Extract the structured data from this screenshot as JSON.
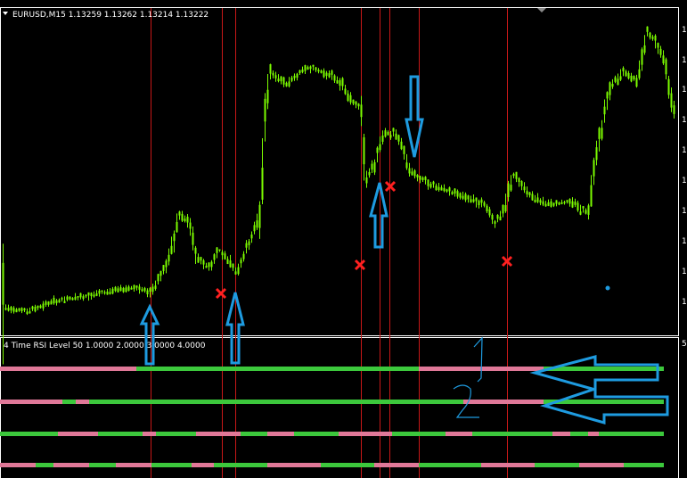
{
  "main_chart": {
    "header": "EURUSD,M15  1.13259 1.13262 1.13214 1.13222",
    "price_axis_ticks": [
      "1",
      "1",
      "1",
      "1",
      "1",
      "1",
      "1",
      "1",
      "1",
      "1"
    ]
  },
  "sub_window": {
    "header": "4 Time RSI Level 50 1.0000 2.0000 3.0000 4.0000",
    "axis_tick": "5"
  },
  "annotations": {
    "handwritten_labels": [
      "1",
      "2"
    ]
  },
  "colors": {
    "candle": "#7CFC00",
    "vline": "#c81818",
    "bull_bar": "#3cc83c",
    "bear_bar": "#e07898",
    "arrow_stroke": "#1e9be0",
    "cross": "#ff2020",
    "window_border": "#ffffff"
  }
}
